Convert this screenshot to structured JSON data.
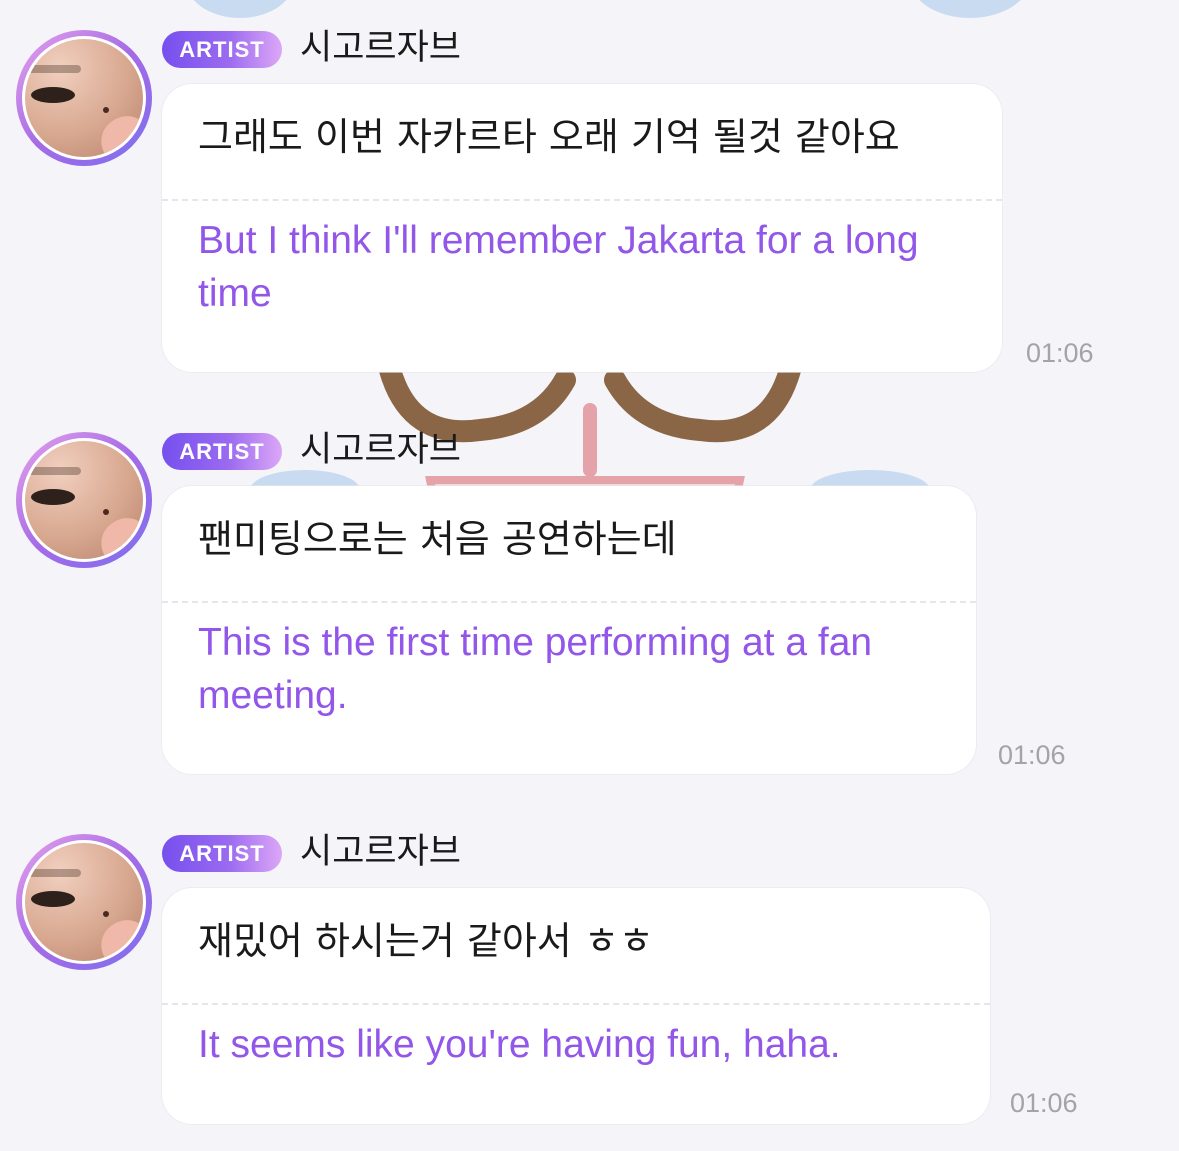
{
  "messages": [
    {
      "badge": "ARTIST",
      "sender": "시고르자브",
      "original": "그래도 이번 자카르타 오래 기억 될것 같아요",
      "translation": "But I think I'll remember Jakarta for a long time",
      "time": "01:06"
    },
    {
      "badge": "ARTIST",
      "sender": "시고르자브",
      "original": "팬미팅으로는 처음 공연하는데",
      "translation": "This is the first time performing at a fan meeting.",
      "time": "01:06"
    },
    {
      "badge": "ARTIST",
      "sender": "시고르자브",
      "original": "재밌어 하시는거 같아서 ㅎㅎ",
      "translation": "It seems like you're having fun, haha.",
      "time": "01:06"
    }
  ],
  "colors": {
    "background": "#f5f4f8",
    "translation_text": "#9256e8",
    "badge_gradient_start": "#7650ee",
    "badge_gradient_end": "#dca7f6",
    "timestamp": "#a3a3a8"
  },
  "icons": {
    "avatar": "artist-profile-photo",
    "background": "puppy-sticker-decoration"
  }
}
